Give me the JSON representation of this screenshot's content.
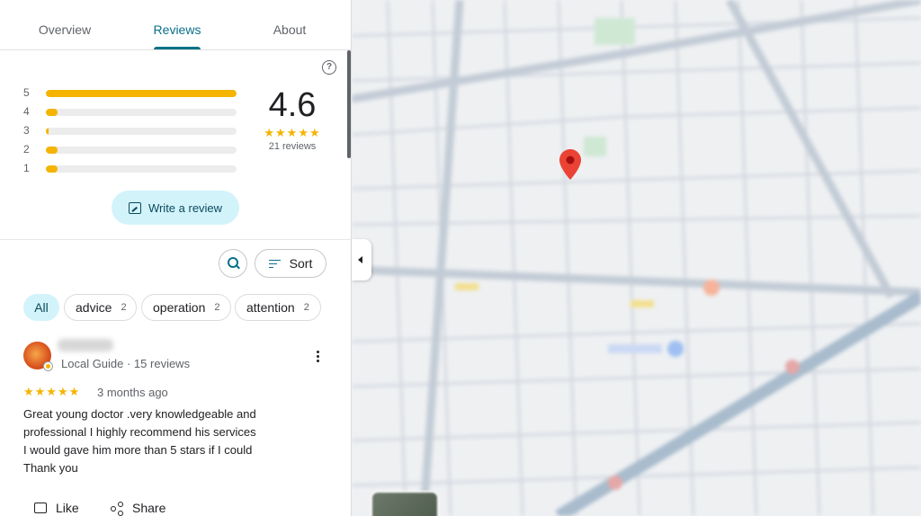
{
  "tabs": [
    {
      "label": "Overview"
    },
    {
      "label": "Reviews"
    },
    {
      "label": "About"
    }
  ],
  "rating": {
    "average": "4.6",
    "stars": "★★★★★",
    "count_label": "21 reviews",
    "distribution": [
      {
        "stars": "5",
        "fraction": 1.0
      },
      {
        "stars": "4",
        "fraction": 0.06
      },
      {
        "stars": "3",
        "fraction": 0.01
      },
      {
        "stars": "2",
        "fraction": 0.06
      },
      {
        "stars": "1",
        "fraction": 0.06
      }
    ],
    "help_icon": "question-circle-icon"
  },
  "write_review": {
    "label": "Write a review",
    "icon": "rate-review-icon"
  },
  "controls": {
    "sort_label": "Sort",
    "search_icon": "search-icon",
    "sort_icon": "sort-icon"
  },
  "filters": [
    {
      "label": "All",
      "count": ""
    },
    {
      "label": "advice",
      "count": "2"
    },
    {
      "label": "operation",
      "count": "2"
    },
    {
      "label": "attention",
      "count": "2"
    }
  ],
  "review": {
    "meta": "Local Guide · 15 reviews",
    "stars": "★★★★★",
    "date": "3 months ago",
    "text_lines": [
      "Great young doctor .very knowledgeable and",
      "professional  I highly recommend his services",
      "I would gave him more than 5 stars if I could",
      "Thank you"
    ],
    "actions": {
      "like": "Like",
      "share": "Share"
    }
  },
  "colors": {
    "accent": "#0b6f8a",
    "star": "#f4b400",
    "chip_selected": "#d3f3fb",
    "pin": "#ea4335"
  }
}
